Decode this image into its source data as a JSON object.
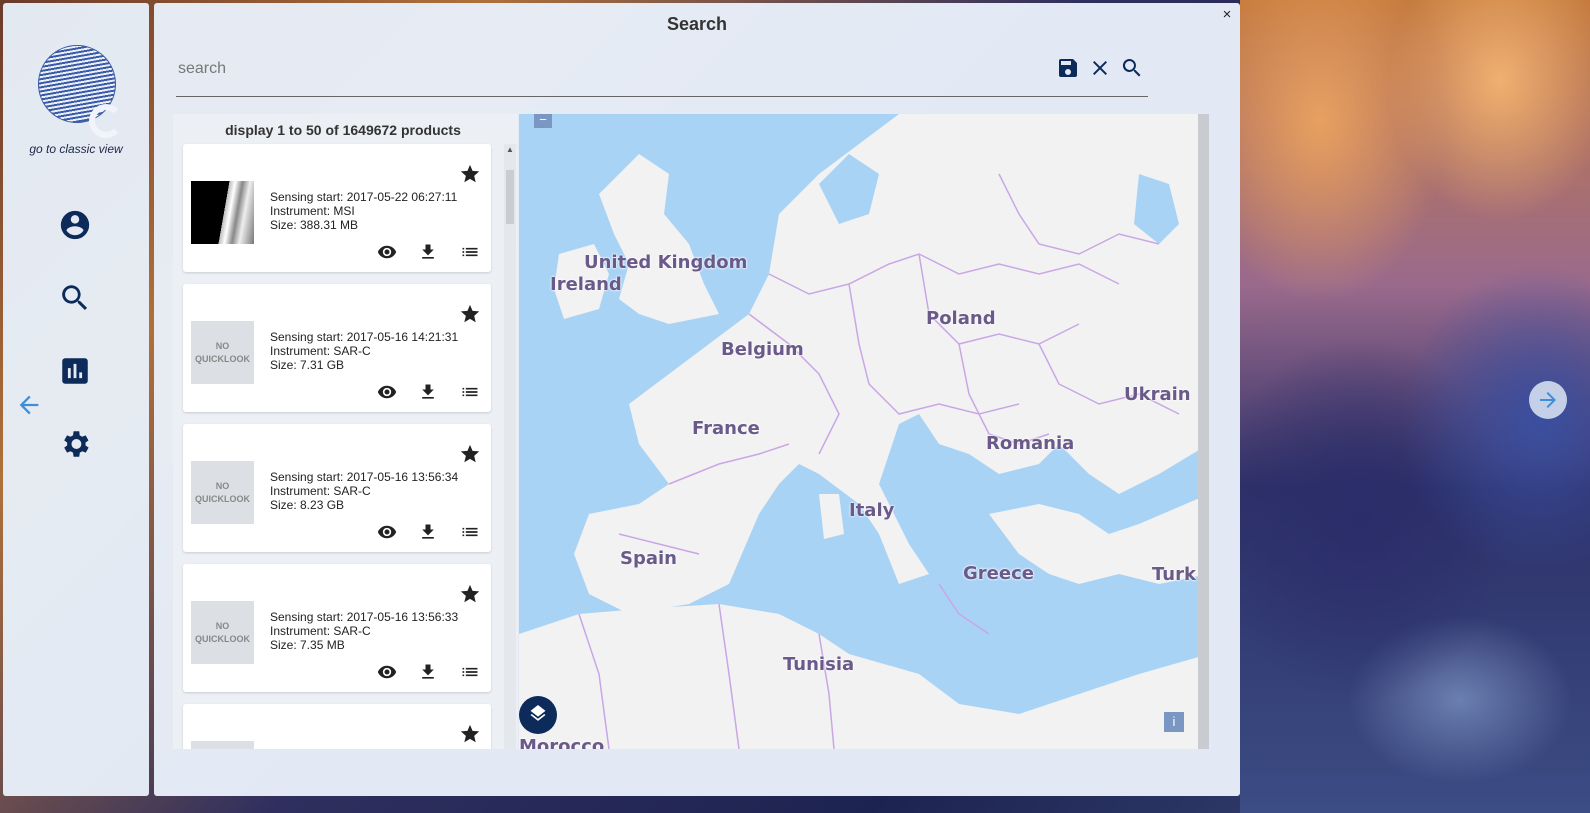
{
  "sidebar": {
    "classic_view_link": "go to classic view"
  },
  "panel": {
    "title": "Search",
    "close_label": "×"
  },
  "search": {
    "placeholder": "search"
  },
  "results": {
    "count_label": "display 1 to 50 of 1649672 products",
    "no_quicklook": "NO QUICKLOOK",
    "items": [
      {
        "sensing": "Sensing start: 2017-05-22 06:27:11",
        "instrument": "Instrument: MSI",
        "size": "Size: 388.31 MB",
        "has_quicklook": true
      },
      {
        "sensing": "Sensing start: 2017-05-16 14:21:31",
        "instrument": "Instrument: SAR-C",
        "size": "Size: 7.31 GB",
        "has_quicklook": false
      },
      {
        "sensing": "Sensing start: 2017-05-16 13:56:34",
        "instrument": "Instrument: SAR-C",
        "size": "Size: 8.23 GB",
        "has_quicklook": false
      },
      {
        "sensing": "Sensing start: 2017-05-16 13:56:33",
        "instrument": "Instrument: SAR-C",
        "size": "Size: 7.35 MB",
        "has_quicklook": false
      }
    ]
  },
  "map": {
    "labels": [
      "United Kingdom",
      "Ireland",
      "Belgium",
      "Poland",
      "France",
      "Romania",
      "Ukrain",
      "Italy",
      "Spain",
      "Greece",
      "Turk",
      "Tunisia",
      "Morocco"
    ],
    "zoom_out": "−",
    "info": "i"
  },
  "colors": {
    "accent": "#0c2a5a",
    "arrow": "#3f8fd8",
    "sea": "#a9d3f5",
    "land": "#f2f2f2",
    "border": "#c9a6e6"
  }
}
